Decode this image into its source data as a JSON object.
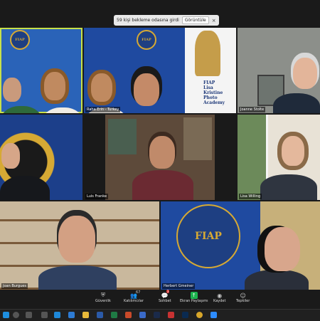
{
  "notification": {
    "text": "59 kişi bekleme odasına girdi",
    "view_label": "Görüntüle",
    "close_symbol": "×"
  },
  "participants": [
    {
      "name": ""
    },
    {
      "name": "Raha Erin - Turkey"
    },
    {
      "name": "Joanne Stolte"
    },
    {
      "name": ""
    },
    {
      "name": "Luis Franke"
    },
    {
      "name": "Lisa Willing"
    },
    {
      "name": "Joan Burgues"
    },
    {
      "name": "Herbert Gmeiner"
    }
  ],
  "poster": {
    "line1": "FIAP",
    "line2": "Lisa",
    "line3": "Kristine",
    "line4": "Photo",
    "line5": "Academy"
  },
  "toolbar": {
    "security": "Güvenlik",
    "participants": "Katılımcılar",
    "participants_count": "67",
    "chat": "Sohbet",
    "chat_badge": "3",
    "share": "Ekran Paylaşımı",
    "record": "Kaydet",
    "reactions": "Tepkiler"
  },
  "colors": {
    "accent_green": "#1db34e",
    "active_speaker": "#c7e04a",
    "fiap_blue": "#1e3f82",
    "fiap_gold": "#d6a934"
  },
  "icons": [
    "shield-icon",
    "participants-icon",
    "chat-icon",
    "share-screen-icon",
    "record-icon",
    "reactions-icon",
    "close-icon",
    "windows-start-icon",
    "search-icon"
  ]
}
